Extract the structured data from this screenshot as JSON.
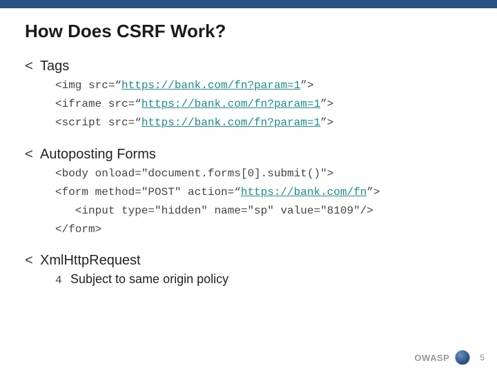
{
  "title": "How Does CSRF Work?",
  "bullets": {
    "tags": {
      "label": "Tags",
      "lines": {
        "img_pre": "<img src=“",
        "img_url": "https://bank.com/fn?param=1",
        "img_post": "”>",
        "iframe_pre": "<iframe src=“",
        "iframe_url": "https://bank.com/fn?param=1",
        "iframe_post": "”>",
        "script_pre": "<script src=“",
        "script_url": "https://bank.com/fn?param=1",
        "script_post": "”>"
      }
    },
    "autopost": {
      "label": "Autoposting Forms",
      "lines": {
        "body": "<body onload=\"document.forms[0].submit()\">",
        "form_pre": "<form method=\"POST\" action=“",
        "form_url": "https://bank.com/fn",
        "form_post": "”>",
        "input": "   <input type=\"hidden\" name=\"sp\" value=\"8109\"/>",
        "formclose": "</form>"
      }
    },
    "xhr": {
      "label": "XmlHttpRequest",
      "sub_marker": "4",
      "sub_label": "Subject to same origin policy"
    }
  },
  "marker": "<",
  "footer": {
    "brand": "OWASP",
    "page": "5"
  }
}
